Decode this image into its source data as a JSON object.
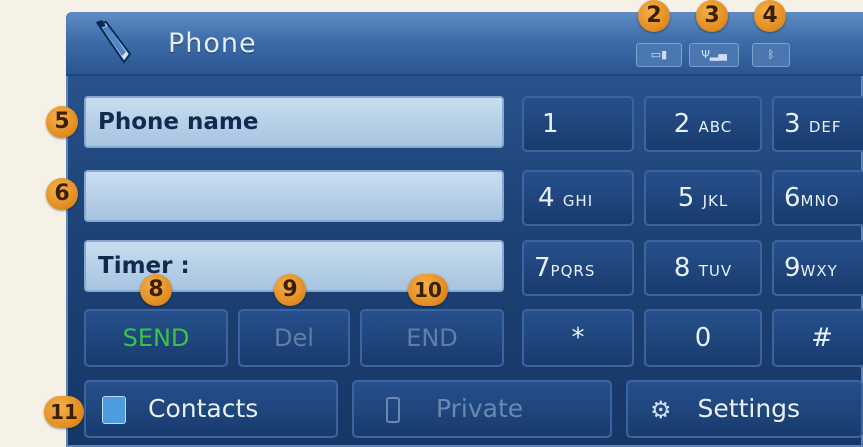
{
  "header": {
    "title": "Phone",
    "icon": "phone-handset-icon",
    "status_icons": [
      "battery-icon",
      "signal-strength-icon",
      "bluetooth-icon"
    ]
  },
  "fields": {
    "phone_name": "Phone name",
    "number": "",
    "timer": "Timer :"
  },
  "keypad": [
    {
      "digit": "1",
      "letters": ""
    },
    {
      "digit": "2",
      "letters": "ABC"
    },
    {
      "digit": "3",
      "letters": "DEF"
    },
    {
      "digit": "4",
      "letters": "GHI"
    },
    {
      "digit": "5",
      "letters": "JKL"
    },
    {
      "digit": "6",
      "letters": "MNO"
    },
    {
      "digit": "7",
      "letters": "PQRS"
    },
    {
      "digit": "8",
      "letters": "TUV"
    },
    {
      "digit": "9",
      "letters": "WXY"
    },
    {
      "digit": "*",
      "letters": ""
    },
    {
      "digit": "0",
      "letters": ""
    },
    {
      "digit": "#",
      "letters": ""
    }
  ],
  "actions": {
    "send": "SEND",
    "del": "Del",
    "end": "END"
  },
  "bottom_bar": {
    "contacts": "Contacts",
    "private": "Private",
    "settings": "Settings"
  },
  "callouts": [
    "2",
    "3",
    "4",
    "5",
    "6",
    "8",
    "9",
    "10",
    "11"
  ],
  "colors": {
    "send_text": "#3cc24a",
    "disabled_text": "#5f7ea8",
    "callout": "#e08a1e",
    "field_bg": "#b7d0ea"
  }
}
